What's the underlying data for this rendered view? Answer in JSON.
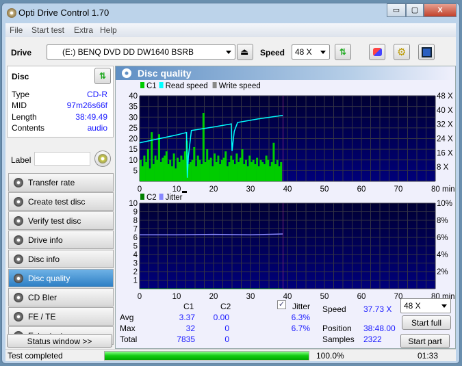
{
  "window": {
    "title": "Opti Drive Control 1.70",
    "minimize": "▭",
    "maximize": "▢",
    "close": "X"
  },
  "menu": [
    "File",
    "Start test",
    "Extra",
    "Help"
  ],
  "toolbar": {
    "drive_label": "Drive",
    "drive_value": "(E:)  BENQ DVD DD DW1640 BSRB",
    "speed_label": "Speed",
    "speed_value": "48 X"
  },
  "disc": {
    "title": "Disc",
    "rows": [
      {
        "k": "Type",
        "v": "CD-R"
      },
      {
        "k": "MID",
        "v": "97m26s66f"
      },
      {
        "k": "Length",
        "v": "38:49.49"
      },
      {
        "k": "Contents",
        "v": "audio"
      }
    ],
    "label_key": "Label",
    "label_value": ""
  },
  "nav": [
    {
      "label": "Transfer rate"
    },
    {
      "label": "Create test disc"
    },
    {
      "label": "Verify test disc"
    },
    {
      "label": "Drive info"
    },
    {
      "label": "Disc info"
    },
    {
      "label": "Disc quality",
      "selected": true
    },
    {
      "label": "CD Bler"
    },
    {
      "label": "FE / TE"
    },
    {
      "label": "Extra tests"
    }
  ],
  "status_window": "Status window >>",
  "panel_title": "Disc quality",
  "chart_data": [
    {
      "type": "bar",
      "legend": [
        "C1",
        "Read speed",
        "Write speed"
      ],
      "colors": {
        "C1": "#00cc00",
        "Read speed": "#00ffff",
        "Write speed": "#888888"
      },
      "xlim": [
        0,
        80
      ],
      "xticks": [
        0,
        10,
        20,
        30,
        40,
        50,
        60,
        70,
        80
      ],
      "xunit": "min",
      "ylim": [
        0,
        40
      ],
      "yticks": [
        5,
        10,
        15,
        20,
        25,
        30,
        35,
        40
      ],
      "y2ticks": [
        "8 X",
        "16 X",
        "24 X",
        "32 X",
        "40 X",
        "48 X"
      ],
      "y2lim": [
        0,
        48
      ],
      "c1_step_min": 0.5,
      "c1": [
        10,
        7,
        12,
        9,
        15,
        6,
        23,
        8,
        12,
        10,
        22,
        9,
        11,
        12,
        14,
        8,
        10,
        7,
        13,
        6,
        11,
        9,
        12,
        10,
        14,
        19,
        8,
        9,
        10,
        16,
        7,
        12,
        10,
        8,
        32,
        9,
        15,
        10,
        11,
        7,
        13,
        9,
        12,
        8,
        10,
        11,
        14,
        7,
        9,
        12,
        10,
        8,
        13,
        9,
        11,
        15,
        8,
        10,
        7,
        12,
        9,
        10,
        8,
        11,
        7,
        10,
        9,
        8,
        12,
        10,
        7,
        9,
        18,
        8,
        10,
        7,
        9
      ],
      "read_speed": [
        [
          0,
          21.6
        ],
        [
          5,
          23.8
        ],
        [
          10,
          26
        ],
        [
          12.7,
          27.4
        ],
        [
          12.9,
          2
        ],
        [
          13.2,
          14
        ],
        [
          14,
          28.5
        ],
        [
          20,
          30.5
        ],
        [
          24.8,
          32.2
        ],
        [
          25,
          17
        ],
        [
          25.6,
          28
        ],
        [
          26.5,
          33
        ],
        [
          32,
          35
        ],
        [
          38.8,
          37
        ]
      ]
    },
    {
      "type": "line",
      "legend": [
        "C2",
        "Jitter"
      ],
      "colors": {
        "C2": "#008000",
        "Jitter": "#8888ff"
      },
      "xlim": [
        0,
        80
      ],
      "xticks": [
        0,
        10,
        20,
        30,
        40,
        50,
        60,
        70,
        80
      ],
      "xunit": "min",
      "ylim": [
        0,
        10
      ],
      "yticks": [
        1,
        2,
        3,
        4,
        5,
        6,
        7,
        8,
        9,
        10
      ],
      "y2ticks": [
        "2%",
        "4%",
        "6%",
        "8%",
        "10%"
      ],
      "y2lim": [
        0,
        10
      ],
      "c2": [
        [
          0,
          0
        ],
        [
          38.8,
          0
        ]
      ],
      "jitter": [
        [
          0,
          6.3
        ],
        [
          10,
          6.3
        ],
        [
          20,
          6.35
        ],
        [
          30,
          6.3
        ],
        [
          38.8,
          6.4
        ]
      ]
    }
  ],
  "stats": {
    "c1_header": "C1",
    "c2_header": "C2",
    "jitter_label": "Jitter",
    "jitter_checked": true,
    "rows": [
      {
        "k": "Avg",
        "c1": "3.37",
        "c2": "0.00",
        "j": "6.3%"
      },
      {
        "k": "Max",
        "c1": "32",
        "c2": "0",
        "j": "6.7%"
      },
      {
        "k": "Total",
        "c1": "7835",
        "c2": "0",
        "j": ""
      }
    ],
    "speed_label": "Speed",
    "speed_value": "37.73 X",
    "position_label": "Position",
    "position_value": "38:48.00",
    "samples_label": "Samples",
    "samples_value": "2322",
    "speed_select": "48 X",
    "start_full": "Start full",
    "start_part": "Start part"
  },
  "statusbar": {
    "text": "Test completed",
    "progress": 100,
    "progress_text": "100.0%",
    "time": "01:33"
  }
}
